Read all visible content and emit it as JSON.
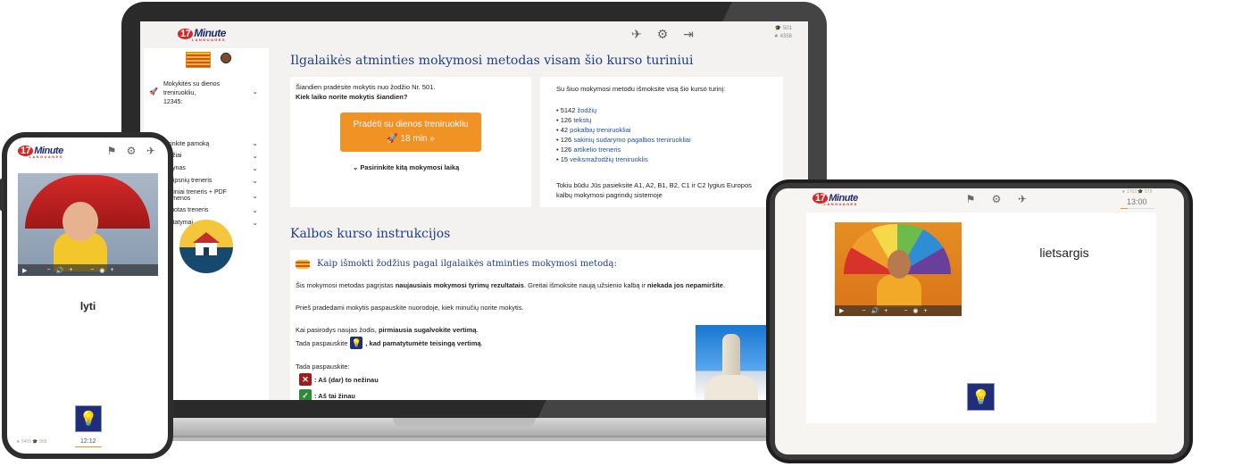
{
  "brand": {
    "num": "17",
    "name": "Minute",
    "sub": "LANGUAGES"
  },
  "laptop": {
    "stats": {
      "words": "501",
      "points": "4358"
    },
    "sidebar": {
      "training_text": "Mokykitės su dienos treniruokliu,",
      "training_num": "12345:",
      "items": [
        {
          "label": "Pasirinkite pamoką"
        },
        {
          "label": "Žodžiai"
        },
        {
          "label": "Žodynas"
        },
        {
          "label": "Straipsnių treneris"
        },
        {
          "label": "Teminiai treneris + PDF rinkmenos"
        },
        {
          "label": "Įklijuotas treneris"
        },
        {
          "label": "Nustatymai"
        }
      ]
    },
    "main": {
      "title1": "Ilgalaikės atminties mokymosi metodas visam šio kurso turiniui",
      "start_text": "Šiandien pradėsite mokytis nuo žodžio Nr. 501.",
      "question": "Kiek laiko norite mokytis šiandien?",
      "start_btn": "Pradėti su dienos treniruokliu",
      "start_time": "18 min",
      "other_time": "Pasirinkite kitą mokymosi laiką",
      "learn_intro": "Su šiuo mokymosi metodu išmoksite visą šio kurso turinį:",
      "list": [
        {
          "num": "5142",
          "link": "žodžių"
        },
        {
          "num": "126",
          "link": "tekstų"
        },
        {
          "num": "42",
          "link": "pokalbių treniruokliai"
        },
        {
          "num": "126",
          "link": "sakinių sudarymo pagalbos treniruokliai"
        },
        {
          "num": "126",
          "link": "artikelio treneris"
        },
        {
          "num": "15",
          "link": "veiksmažodžių treniruoklis"
        }
      ],
      "result1": "Tokiu būdu Jūs pasieksite A1, A2, B1, B2, C1 ir C2 lygius Europos",
      "result2": "kalbų mokymosi pagrindų sistemoje",
      "title2": "Kalbos kurso instrukcijos",
      "subtitle": "Kaip išmokti žodžius pagal ilgalaikės atminties mokymosi metodą:",
      "p1_a": "Šis mokymosi metodas pagrįstas ",
      "p1_b": "naujausiais mokymosi tyrimų rezultatais",
      "p1_c": ". Greitai išmoksite naują užsienio kalbą ir ",
      "p1_d": "niekada jos nepamiršite",
      "p1_e": ".",
      "p2": "Prieš pradedami mokytis paspauskite nuorodoje, kiek minučių norite mokytis.",
      "p3_a": "Kai pasirodys naujas žodis, ",
      "p3_b": "pirmiausia sugalvokite vertimą",
      "p3_c": ".",
      "p4_a": "Tada paspauskite ",
      "p4_b": ", kad pamatytumėte teisingą vertimą",
      "p4_c": ".",
      "p5": "Tada paspauskite:",
      "p6": ": Aš (dar) to nežinau",
      "p7": ": Aš tai žinau"
    }
  },
  "phone": {
    "word": "lyti",
    "time": "12:12",
    "stats_left": "5455",
    "stats_right": "998"
  },
  "tablet": {
    "word": "lietsargis",
    "time": "13:00",
    "stats_left": "1703",
    "stats_right": "578"
  },
  "video_controls": {
    "play": "▶",
    "minus": "−",
    "vol": "🔊",
    "plus": "+",
    "speed": "◉"
  }
}
